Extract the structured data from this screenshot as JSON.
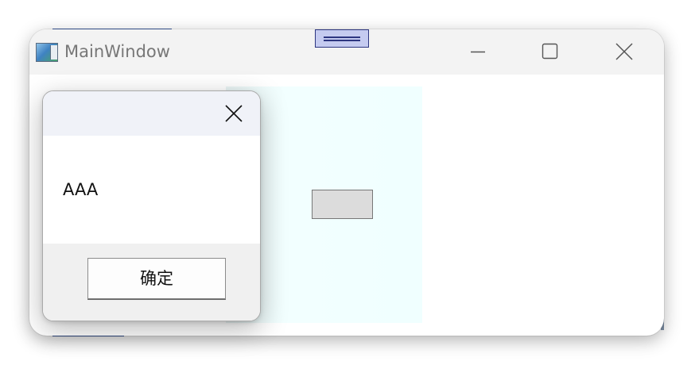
{
  "window": {
    "title": "MainWindow",
    "icon": "app-window-icon",
    "caption_buttons": [
      "minimize-icon",
      "maximize-icon",
      "close-icon"
    ]
  },
  "dialog": {
    "message": "AAA",
    "ok_label": "确定",
    "close_icon": "close-icon"
  },
  "colors": {
    "titlebar": "#f3f3f3",
    "panel": "#f0ffff",
    "dialog_header": "#f0f2f8",
    "dialog_footer": "#f0f0f0",
    "grip": "#c5cbf0"
  }
}
